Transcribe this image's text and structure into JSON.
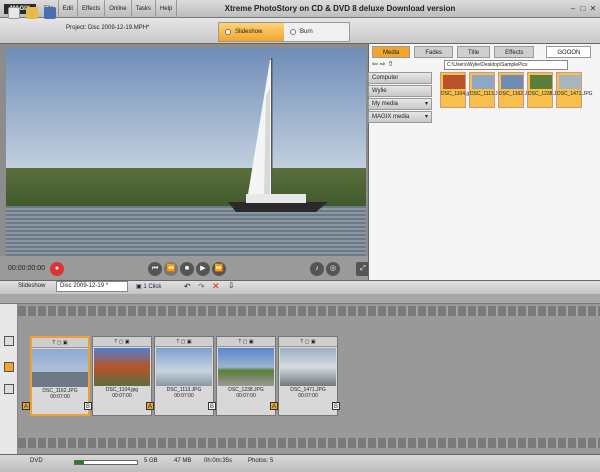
{
  "app": {
    "logo": "MAGIX",
    "title": "Xtreme PhotoStory on CD & DVD 8 deluxe Download version"
  },
  "menu": [
    "File",
    "Edit",
    "Effects",
    "Online",
    "Tasks",
    "Help"
  ],
  "project": "Project: Disc 2009-12-19.MPH*",
  "modes": [
    {
      "label": "Slideshow"
    },
    {
      "label": "Burn"
    }
  ],
  "preview": {
    "timecode": "00:00:00:00"
  },
  "media_tabs": [
    "Media",
    "Fades",
    "Title",
    "Effects"
  ],
  "media_logo": "GOOON",
  "media_path": "C:\\Users\\Wylie\\Desktop\\SamplePics",
  "media_list": [
    "Computer",
    "Wylie",
    "My media",
    "MAGIX media"
  ],
  "media_thumbs": [
    "DSC_1104.jpg",
    "DSC_1113.JPG",
    "DSC_1162.JPG",
    "DSC_1238.JPG",
    "DSC_1471.JPG"
  ],
  "storyboard": {
    "label": "Slideshow",
    "disc": "Disc 2009-12-19 *",
    "one_click": "1 Click"
  },
  "clips": [
    {
      "name": "DSC_1162.JPG",
      "dur": "00:07:00"
    },
    {
      "name": "DSC_1104.jpg",
      "dur": "00:07:00"
    },
    {
      "name": "DSC_1113.JPG",
      "dur": "00:07:00"
    },
    {
      "name": "DSC_1238.JPG",
      "dur": "00:07:00"
    },
    {
      "name": "DSC_1471.JPG",
      "dur": "00:07:00"
    }
  ],
  "status": {
    "format": "DVD",
    "capacity": "5 GB",
    "size": "47 MB",
    "time": "0h:0m:35s",
    "photos": "Photos: 5"
  }
}
